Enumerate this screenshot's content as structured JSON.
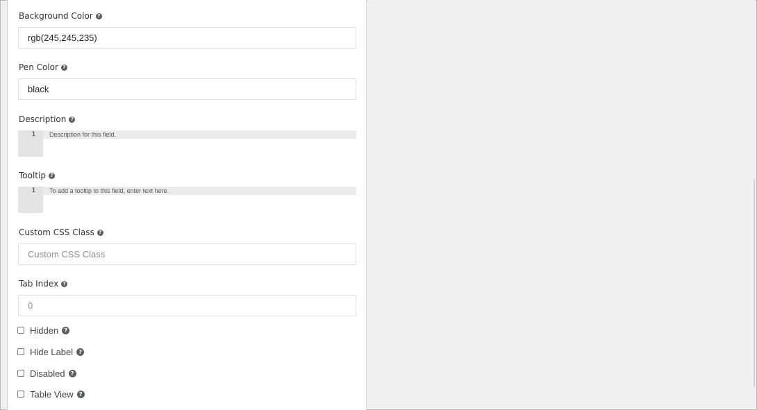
{
  "form": {
    "background_color": {
      "label": "Background Color",
      "value": "rgb(245,245,235)"
    },
    "pen_color": {
      "label": "Pen Color",
      "value": "black"
    },
    "description": {
      "label": "Description",
      "line_number": "1",
      "text": "Description for this field."
    },
    "tooltip": {
      "label": "Tooltip",
      "line_number": "1",
      "text": "To add a tooltip to this field, enter text here."
    },
    "custom_css_class": {
      "label": "Custom CSS Class",
      "placeholder": "Custom CSS Class"
    },
    "tab_index": {
      "label": "Tab Index",
      "placeholder": "0"
    },
    "checkboxes": [
      {
        "label": "Hidden",
        "checked": false
      },
      {
        "label": "Hide Label",
        "checked": false
      },
      {
        "label": "Disabled",
        "checked": false
      },
      {
        "label": "Table View",
        "checked": false
      }
    ],
    "help_glyph": "?"
  },
  "colors": {
    "panel_bg": "#ffffff",
    "page_bg": "#f0f0f0",
    "help_icon": "#5b5f63"
  },
  "icons": [
    "question-circle-icon"
  ]
}
